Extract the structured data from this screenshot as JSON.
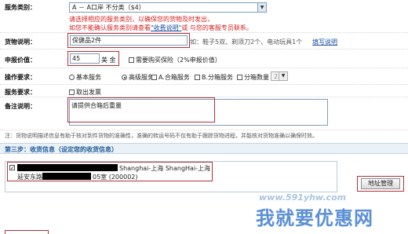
{
  "service_type": {
    "label": "服务类别：",
    "selected": "A － A口岸 不分类（$4）",
    "note_1": "请选择相应的服务类别，以确保您的货物及时发出，",
    "note_2_prefix": "如您不能确认服务类别请查看",
    "note_2_link": "\"收费说明\"",
    "note_2_suffix": "或 与您的客服专员联系。"
  },
  "goods_desc": {
    "label": "货物说明：",
    "value": "保健品2件",
    "example": "如：鞋子5双、剃须刀2个、电动玩具1个",
    "link": "填写说明"
  },
  "declared_value": {
    "label": "申报价值：",
    "value": "45",
    "unit": "美 金",
    "insurance_label": "需要购买保险（2%申报价值）"
  },
  "operation": {
    "label": "操作要求：",
    "basic": "基本服务",
    "premium": "高级服务",
    "merge": "A.合箱服务",
    "split": "B.分箱服务",
    "split_count_label": "分箱数量",
    "split_count": "2"
  },
  "service_req": {
    "label": "服务要求：",
    "remove_invoice": "取出发票"
  },
  "remarks": {
    "label": "备注说明：",
    "value": "请提供合箱后重量"
  },
  "footnote": "注：货物说明描述信息有助于核对到件货物的准确性，准确的转运号码不仅有助于跟踪货物进程，并能核对货物准确以确保时效。",
  "step3": {
    "title": "第三步：收货信息（设定您的收货信息）",
    "address_line1": "Shanghai-上海 ShangHai-上海",
    "address_line2_prefix": "延安东路",
    "address_line2_suffix": "05室 (200002)",
    "manage_button": "地址管理"
  },
  "watermark": {
    "url": "www.591yhw.com",
    "brand": "我就要优惠网"
  }
}
